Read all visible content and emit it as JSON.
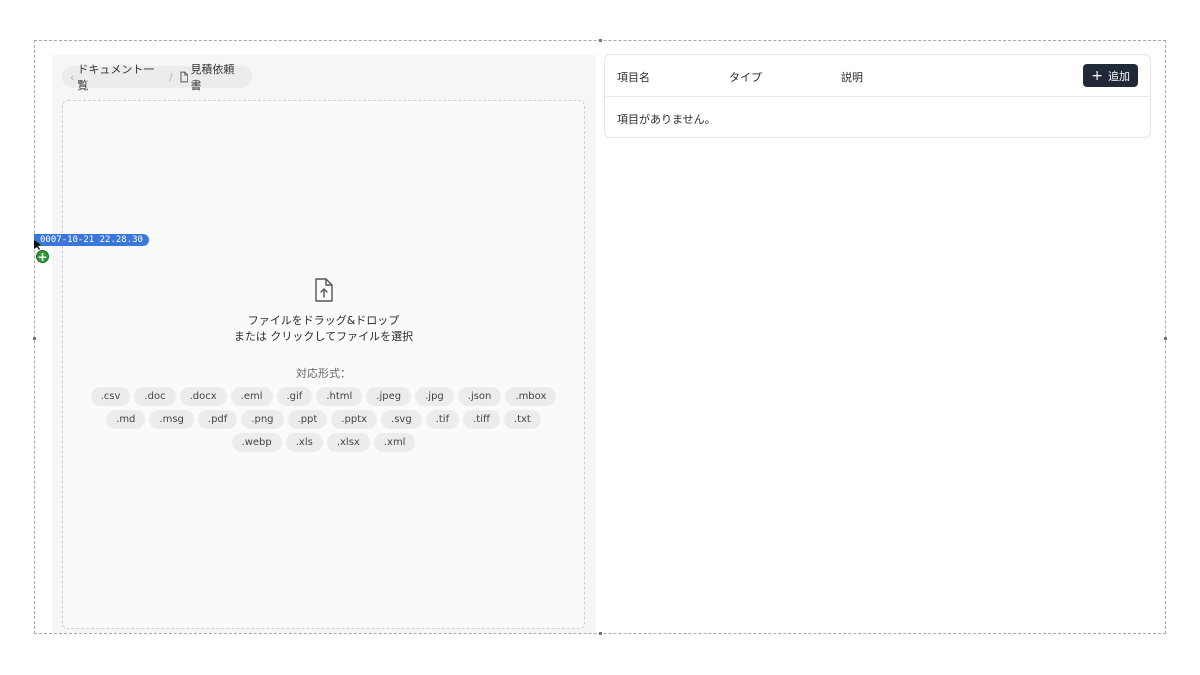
{
  "breadcrumb": {
    "back_label": "ドキュメント一覧",
    "separator": "/",
    "current_label": "見積依頼書"
  },
  "dropzone": {
    "line1": "ファイルをドラッグ&ドロップ",
    "line2": "または クリックしてファイルを選択",
    "formats_label": "対応形式：",
    "formats": [
      ".csv",
      ".doc",
      ".docx",
      ".eml",
      ".gif",
      ".html",
      ".jpeg",
      ".jpg",
      ".json",
      ".mbox",
      ".md",
      ".msg",
      ".pdf",
      ".png",
      ".ppt",
      ".pptx",
      ".svg",
      ".tif",
      ".tiff",
      ".txt",
      ".webp",
      ".xls",
      ".xlsx",
      ".xml"
    ]
  },
  "table": {
    "columns": [
      "項目名",
      "タイプ",
      "説明"
    ],
    "add_label": "追加",
    "empty_text": "項目がありません。"
  },
  "overlay": {
    "timestamp": "0007-10-21 22.28.30",
    "plus_symbol": "+"
  }
}
